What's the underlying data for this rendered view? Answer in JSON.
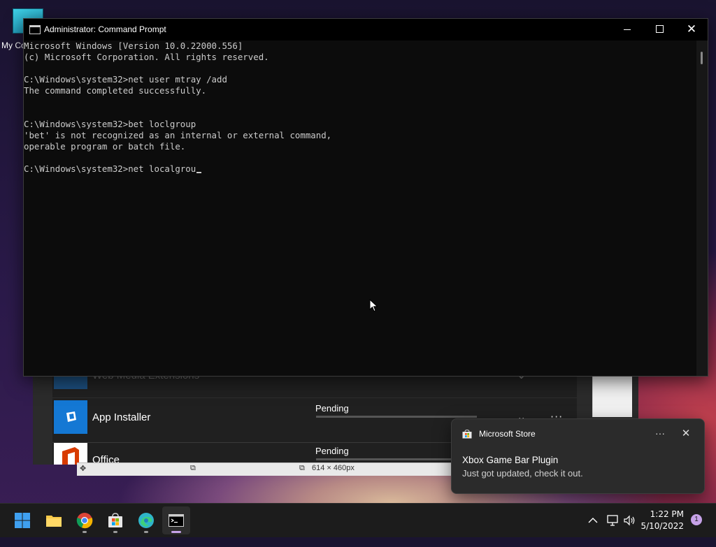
{
  "desktop": {
    "icon_label": "My Co"
  },
  "cmd": {
    "title": "Administrator: Command Prompt",
    "lines": [
      "Microsoft Windows [Version 10.0.22000.556]",
      "(c) Microsoft Corporation. All rights reserved.",
      "",
      "C:\\Windows\\system32>net user mtray /add",
      "The command completed successfully.",
      "",
      "",
      "C:\\Windows\\system32>bet loclgroup",
      "'bet' is not recognized as an internal or external command,",
      "operable program or batch file.",
      "",
      "C:\\Windows\\system32>net localgrou"
    ]
  },
  "store_bg": {
    "rows": [
      {
        "name": "Web Media Extensions",
        "status": ""
      },
      {
        "name": "App Installer",
        "status": "Pending"
      },
      {
        "name": "Office",
        "status": "Pending"
      }
    ]
  },
  "snip": {
    "size_label": "614 × 460px"
  },
  "toast": {
    "app_name": "Microsoft Store",
    "title": "Xbox Game Bar Plugin",
    "message": "Just got updated, check it out."
  },
  "taskbar": {
    "apps": [
      "Start",
      "File Explorer",
      "Google Chrome",
      "Microsoft Store",
      "Microsoft Edge",
      "Command Prompt"
    ],
    "time": "1:22 PM",
    "date": "5/10/2022",
    "notification_count": "1"
  }
}
